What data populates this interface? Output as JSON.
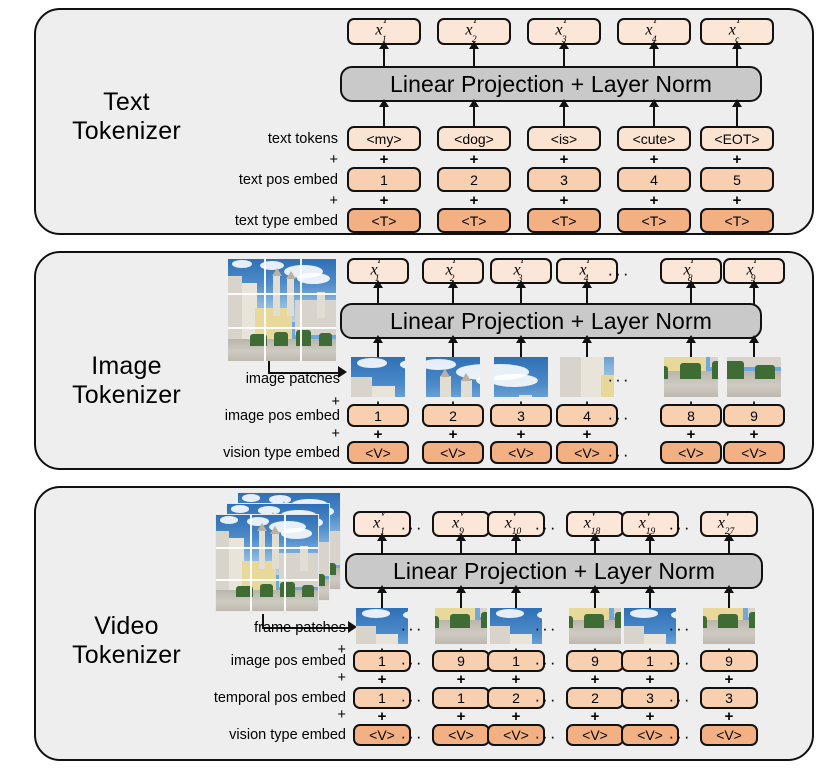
{
  "figure": {
    "type": "diagram",
    "description": "Three tokenizer pipelines: text, image, and video, each feeding a Linear Projection + Layer Norm block."
  },
  "colors": {
    "panel_background": "#eeeeee",
    "panel_border": "#111111",
    "projection_bar": "#c9c9c9",
    "token_lightest": "#fbe3d2",
    "token_light": "#f8d0b0",
    "token_medium": "#f3b183",
    "output_token": "#fce6d7"
  },
  "panels": [
    {
      "id": "text",
      "title": "Text\nTokenizer",
      "projection_label": "Linear Projection + Layer Norm",
      "row_labels": [
        "text tokens",
        "text pos embed",
        "text type embed"
      ],
      "plus_separators": [
        "+",
        "+"
      ],
      "outputs": [
        {
          "base": "x",
          "sup": "T",
          "sub": "1"
        },
        {
          "base": "x",
          "sup": "T",
          "sub": "2"
        },
        {
          "base": "x",
          "sup": "T",
          "sub": "3"
        },
        {
          "base": "x",
          "sup": "T",
          "sub": "4"
        },
        {
          "base": "x",
          "sup": "T",
          "sub": "c"
        }
      ],
      "tokens": [
        "<my>",
        "<dog>",
        "<is>",
        "<cute>",
        "<EOT>"
      ],
      "pos_embed": [
        "1",
        "2",
        "3",
        "4",
        "5"
      ],
      "type_embed": [
        "<T>",
        "<T>",
        "<T>",
        "<T>",
        "<T>"
      ],
      "column_plus": "+"
    },
    {
      "id": "image",
      "title": "Image\nTokenizer",
      "projection_label": "Linear Projection + Layer Norm",
      "row_labels": [
        "image patches",
        "image pos embed",
        "vision type embed"
      ],
      "plus_separators": [
        "+",
        "+"
      ],
      "outputs": [
        {
          "base": "x",
          "sup": "I",
          "sub": "1"
        },
        {
          "base": "x",
          "sup": "I",
          "sub": "2"
        },
        {
          "base": "x",
          "sup": "I",
          "sub": "3"
        },
        {
          "base": "x",
          "sup": "I",
          "sub": "4"
        },
        {
          "base": "x",
          "sup": "I",
          "sub": "8"
        },
        {
          "base": "x",
          "sup": "I",
          "sub": "9"
        }
      ],
      "pos_embed": [
        "1",
        "2",
        "3",
        "4",
        "8",
        "9"
      ],
      "type_embed": [
        "<V>",
        "<V>",
        "<V>",
        "<V>",
        "<V>",
        "<V>"
      ],
      "ellipsis": "···",
      "column_plus": "+",
      "source_image_grid": "3x3"
    },
    {
      "id": "video",
      "title": "Video\nTokenizer",
      "projection_label": "Linear Projection + Layer Norm",
      "row_labels": [
        "frame patches",
        "image pos embed",
        "temporal pos embed",
        "vision type embed"
      ],
      "plus_separators": [
        "+",
        "+",
        "+"
      ],
      "outputs": [
        {
          "base": "x",
          "sup": "V",
          "sub": "1"
        },
        {
          "base": "x",
          "sup": "V",
          "sub": "9"
        },
        {
          "base": "x",
          "sup": "V",
          "sub": "10"
        },
        {
          "base": "x",
          "sup": "V",
          "sub": "18"
        },
        {
          "base": "x",
          "sup": "V",
          "sub": "19"
        },
        {
          "base": "x",
          "sup": "V",
          "sub": "27"
        }
      ],
      "pos_embed": [
        "1",
        "9",
        "1",
        "9",
        "1",
        "9"
      ],
      "temporal_embed": [
        "1",
        "1",
        "2",
        "2",
        "3",
        "3"
      ],
      "type_embed": [
        "<V>",
        "<V>",
        "<V>",
        "<V>",
        "<V>",
        "<V>"
      ],
      "ellipsis": "···",
      "column_plus": "+",
      "frames": 3
    }
  ]
}
